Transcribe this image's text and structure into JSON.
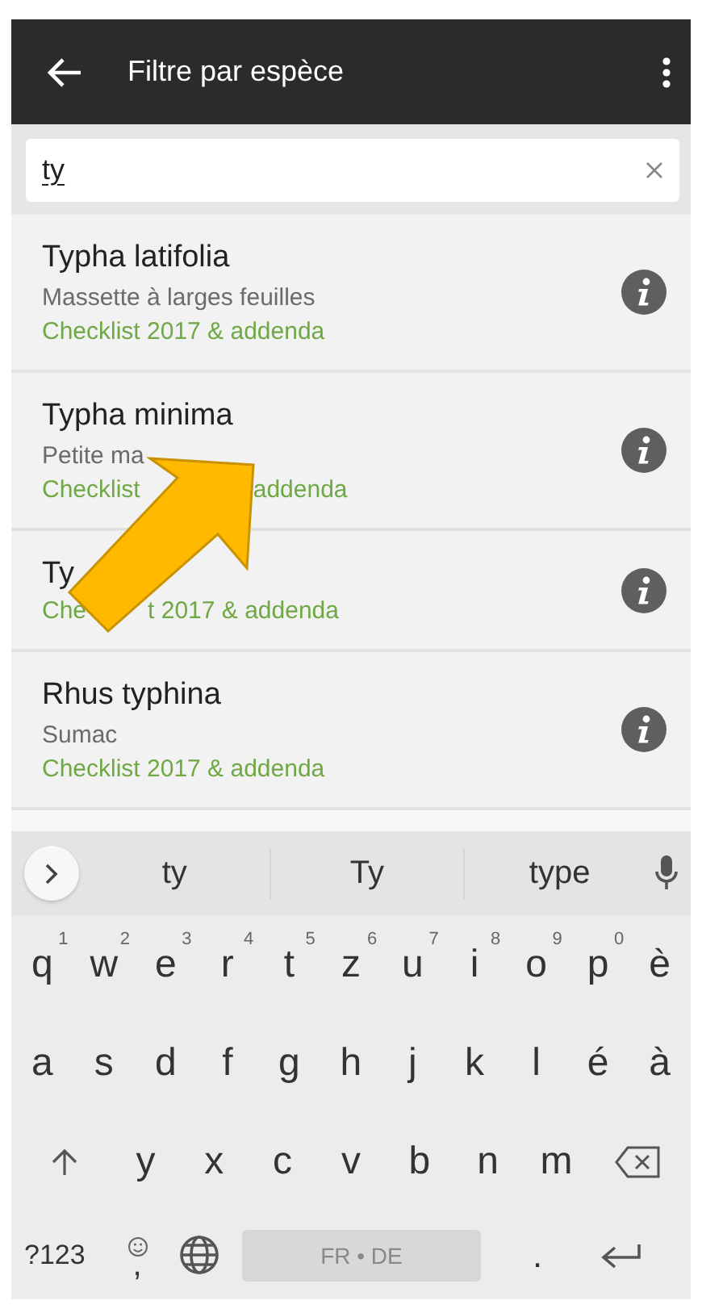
{
  "app_bar": {
    "title": "Filtre par espèce"
  },
  "search": {
    "value": "ty"
  },
  "results": [
    {
      "name": "Typha latifolia",
      "common_name": "Massette à larges feuilles",
      "source": "Checklist 2017 & addenda"
    },
    {
      "name": "Typha minima",
      "common_name": "Petite ma",
      "source": [
        "Checklist",
        "addenda"
      ]
    },
    {
      "name": "Ty",
      "source": [
        "Che",
        "t 2017 & addenda"
      ]
    },
    {
      "name": "Rhus typhina",
      "common_name": "Sumac",
      "source": "Checklist 2017 & addenda"
    }
  ],
  "keyboard": {
    "suggestions": [
      "ty",
      "Ty",
      "type"
    ],
    "row1": [
      {
        "label": "q",
        "hint": "1"
      },
      {
        "label": "w",
        "hint": "2"
      },
      {
        "label": "e",
        "hint": "3"
      },
      {
        "label": "r",
        "hint": "4"
      },
      {
        "label": "t",
        "hint": "5"
      },
      {
        "label": "z",
        "hint": "6"
      },
      {
        "label": "u",
        "hint": "7"
      },
      {
        "label": "i",
        "hint": "8"
      },
      {
        "label": "o",
        "hint": "9"
      },
      {
        "label": "p",
        "hint": "0"
      },
      {
        "label": "è"
      }
    ],
    "row2": [
      "a",
      "s",
      "d",
      "f",
      "g",
      "h",
      "j",
      "k",
      "l",
      "é",
      "à"
    ],
    "row3": [
      "y",
      "x",
      "c",
      "v",
      "b",
      "n",
      "m"
    ],
    "symbols_key": "?123",
    "comma_key": ",",
    "space_key": "FR • DE",
    "period_key": "."
  }
}
